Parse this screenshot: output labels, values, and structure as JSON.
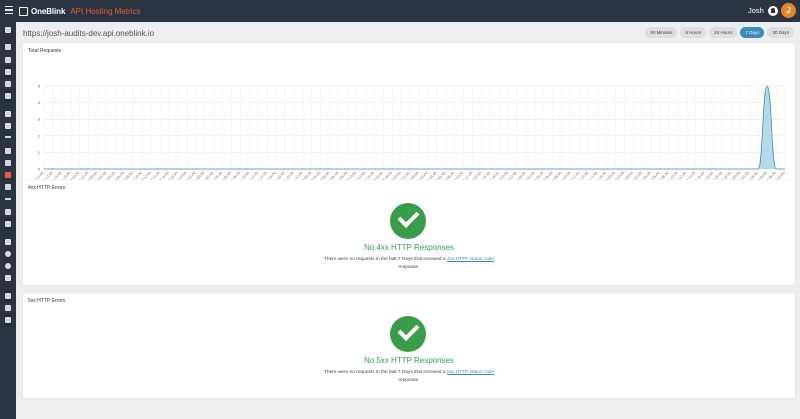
{
  "app": {
    "brand": "OneBlink",
    "title": "API Hosting Metrics",
    "user_name": "Josh",
    "avatar_initial": "J"
  },
  "sidebar": {
    "items": [
      "home-icon",
      "dashboard-icon",
      "apps-icon",
      "forms-icon",
      "files-icon",
      "reports-icon",
      "integrations-icon",
      "calendar-icon",
      "list-icon",
      "alerts-icon",
      "email-icon",
      "api-hosting-icon",
      "monitor-icon",
      "analytics-icon",
      "redirect-icon",
      "tools-icon",
      "team-icon",
      "security-icon",
      "visibility-icon",
      "bank-icon",
      "layers-icon",
      "payment-icon",
      "chat-icon"
    ]
  },
  "header": {
    "url": "https://josh-audits-dev.api.oneblink.io",
    "ranges": [
      {
        "label": "60 Minutes",
        "active": false
      },
      {
        "label": "6 Hours",
        "active": false
      },
      {
        "label": "24 Hours",
        "active": false
      },
      {
        "label": "7 Days",
        "active": true
      },
      {
        "label": "30 Days",
        "active": false
      }
    ]
  },
  "total_requests": {
    "title": "Total Requests"
  },
  "chart_data": {
    "type": "area",
    "title": "Total Requests",
    "ylim": [
      0,
      5
    ],
    "yticks": [
      0,
      1,
      2,
      3,
      4,
      5
    ],
    "x_labels": [
      "Tue 12:00",
      "Tue 14:00",
      "Tue 16:00",
      "Tue 18:00",
      "Tue 20:00",
      "Tue 22:00",
      "Wed 00:00",
      "Wed 02:00",
      "Wed 04:00",
      "Wed 06:00",
      "Wed 08:00",
      "Wed 10:00",
      "Wed 12:00",
      "Wed 14:00",
      "Wed 16:00",
      "Wed 18:00",
      "Wed 20:00",
      "Wed 22:00",
      "Thu 00:00",
      "Thu 02:00",
      "Thu 04:00",
      "Thu 06:00",
      "Thu 08:00",
      "Thu 10:00",
      "Thu 12:00",
      "Thu 14:00",
      "Thu 16:00",
      "Thu 18:00",
      "Thu 20:00",
      "Thu 22:00",
      "Fri 00:00",
      "Fri 02:00",
      "Fri 04:00",
      "Fri 06:00",
      "Fri 08:00",
      "Fri 10:00",
      "Fri 12:00",
      "Fri 14:00",
      "Fri 16:00",
      "Fri 18:00",
      "Fri 20:00",
      "Fri 22:00",
      "Sat 00:00",
      "Sat 02:00",
      "Sat 04:00",
      "Sat 06:00",
      "Sat 08:00",
      "Sat 10:00",
      "Sat 12:00",
      "Sat 14:00",
      "Sat 16:00",
      "Sat 18:00",
      "Sat 20:00",
      "Sat 22:00",
      "Sun 00:00",
      "Sun 02:00",
      "Sun 04:00",
      "Sun 06:00",
      "Sun 08:00",
      "Sun 10:00",
      "Sun 12:00",
      "Sun 14:00",
      "Sun 16:00",
      "Sun 18:00",
      "Sun 20:00",
      "Sun 22:00",
      "Mon 00:00",
      "Mon 02:00",
      "Mon 04:00",
      "Mon 06:00",
      "Mon 08:00",
      "Mon 10:00",
      "Mon 12:00",
      "Mon 14:00",
      "Mon 16:00",
      "Mon 18:00",
      "Mon 20:00",
      "Mon 22:00",
      "Tue 00:00",
      "Tue 02:00",
      "Tue 04:00",
      "Tue 06:00",
      "Tue 08:00",
      "Tue 10:00"
    ],
    "series": [
      {
        "values": [
          0,
          0,
          0,
          0,
          0,
          0,
          0,
          0,
          0,
          0,
          0,
          0,
          0,
          0,
          0,
          0,
          0,
          0,
          0,
          0,
          0,
          0,
          0,
          0,
          0,
          0,
          0,
          0,
          0,
          0,
          0,
          0,
          0,
          0,
          0,
          0,
          0,
          0,
          0,
          0,
          0,
          0,
          0,
          0,
          0,
          0,
          0,
          0,
          0,
          0,
          0,
          0,
          0,
          0,
          0,
          0,
          0,
          0,
          0,
          0,
          0,
          0,
          0,
          0,
          0,
          0,
          0,
          0,
          0,
          0,
          0,
          0,
          0,
          0,
          0,
          0,
          0,
          0,
          0,
          0,
          0,
          5,
          0,
          0
        ],
        "color": "#a9d3e4",
        "line_color": "#3a8fb7"
      }
    ],
    "grid": true
  },
  "errors_4xx": {
    "title": "4xx HTTP Errors",
    "heading": "No 4xx HTTP Responses",
    "text_before": "There were no requests in the last 7 Days that received a",
    "link": "4xx HTTP status code",
    "text_after": "response."
  },
  "errors_5xx": {
    "title": "5xx HTTP Errors",
    "heading": "No 5xx HTTP Responses",
    "text_before": "There were no requests in the last 7 Days that received a",
    "link": "5xx HTTP status code",
    "text_after": "response."
  }
}
